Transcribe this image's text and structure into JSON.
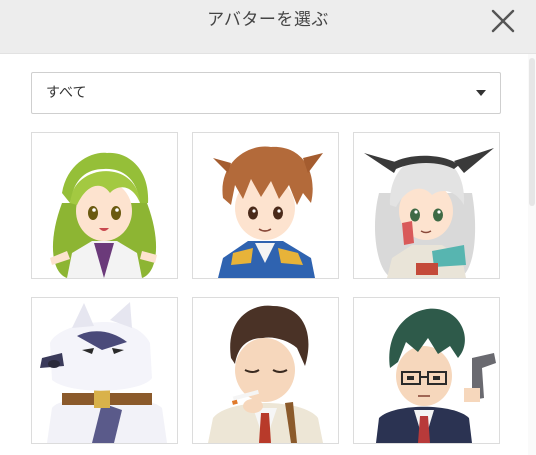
{
  "dialog": {
    "title": "アバターを選ぶ",
    "close_icon": "close-x-icon"
  },
  "filter": {
    "selected": "すべて",
    "caret_icon": "caret-down-icon"
  },
  "avatars": [
    {
      "character": "green-haired-girl",
      "hair": "#9cc23d"
    },
    {
      "character": "brown-haired-boy",
      "hair": "#b36a3a"
    },
    {
      "character": "silver-haired-girl",
      "hair": "#d6d6d6"
    },
    {
      "character": "white-wolf",
      "hair": "#f2f2f8"
    },
    {
      "character": "dark-haired-man-with-cigarette",
      "hair": "#4a3226"
    },
    {
      "character": "green-haired-man-with-glasses-and-gun",
      "hair": "#2e5a4a"
    }
  ]
}
